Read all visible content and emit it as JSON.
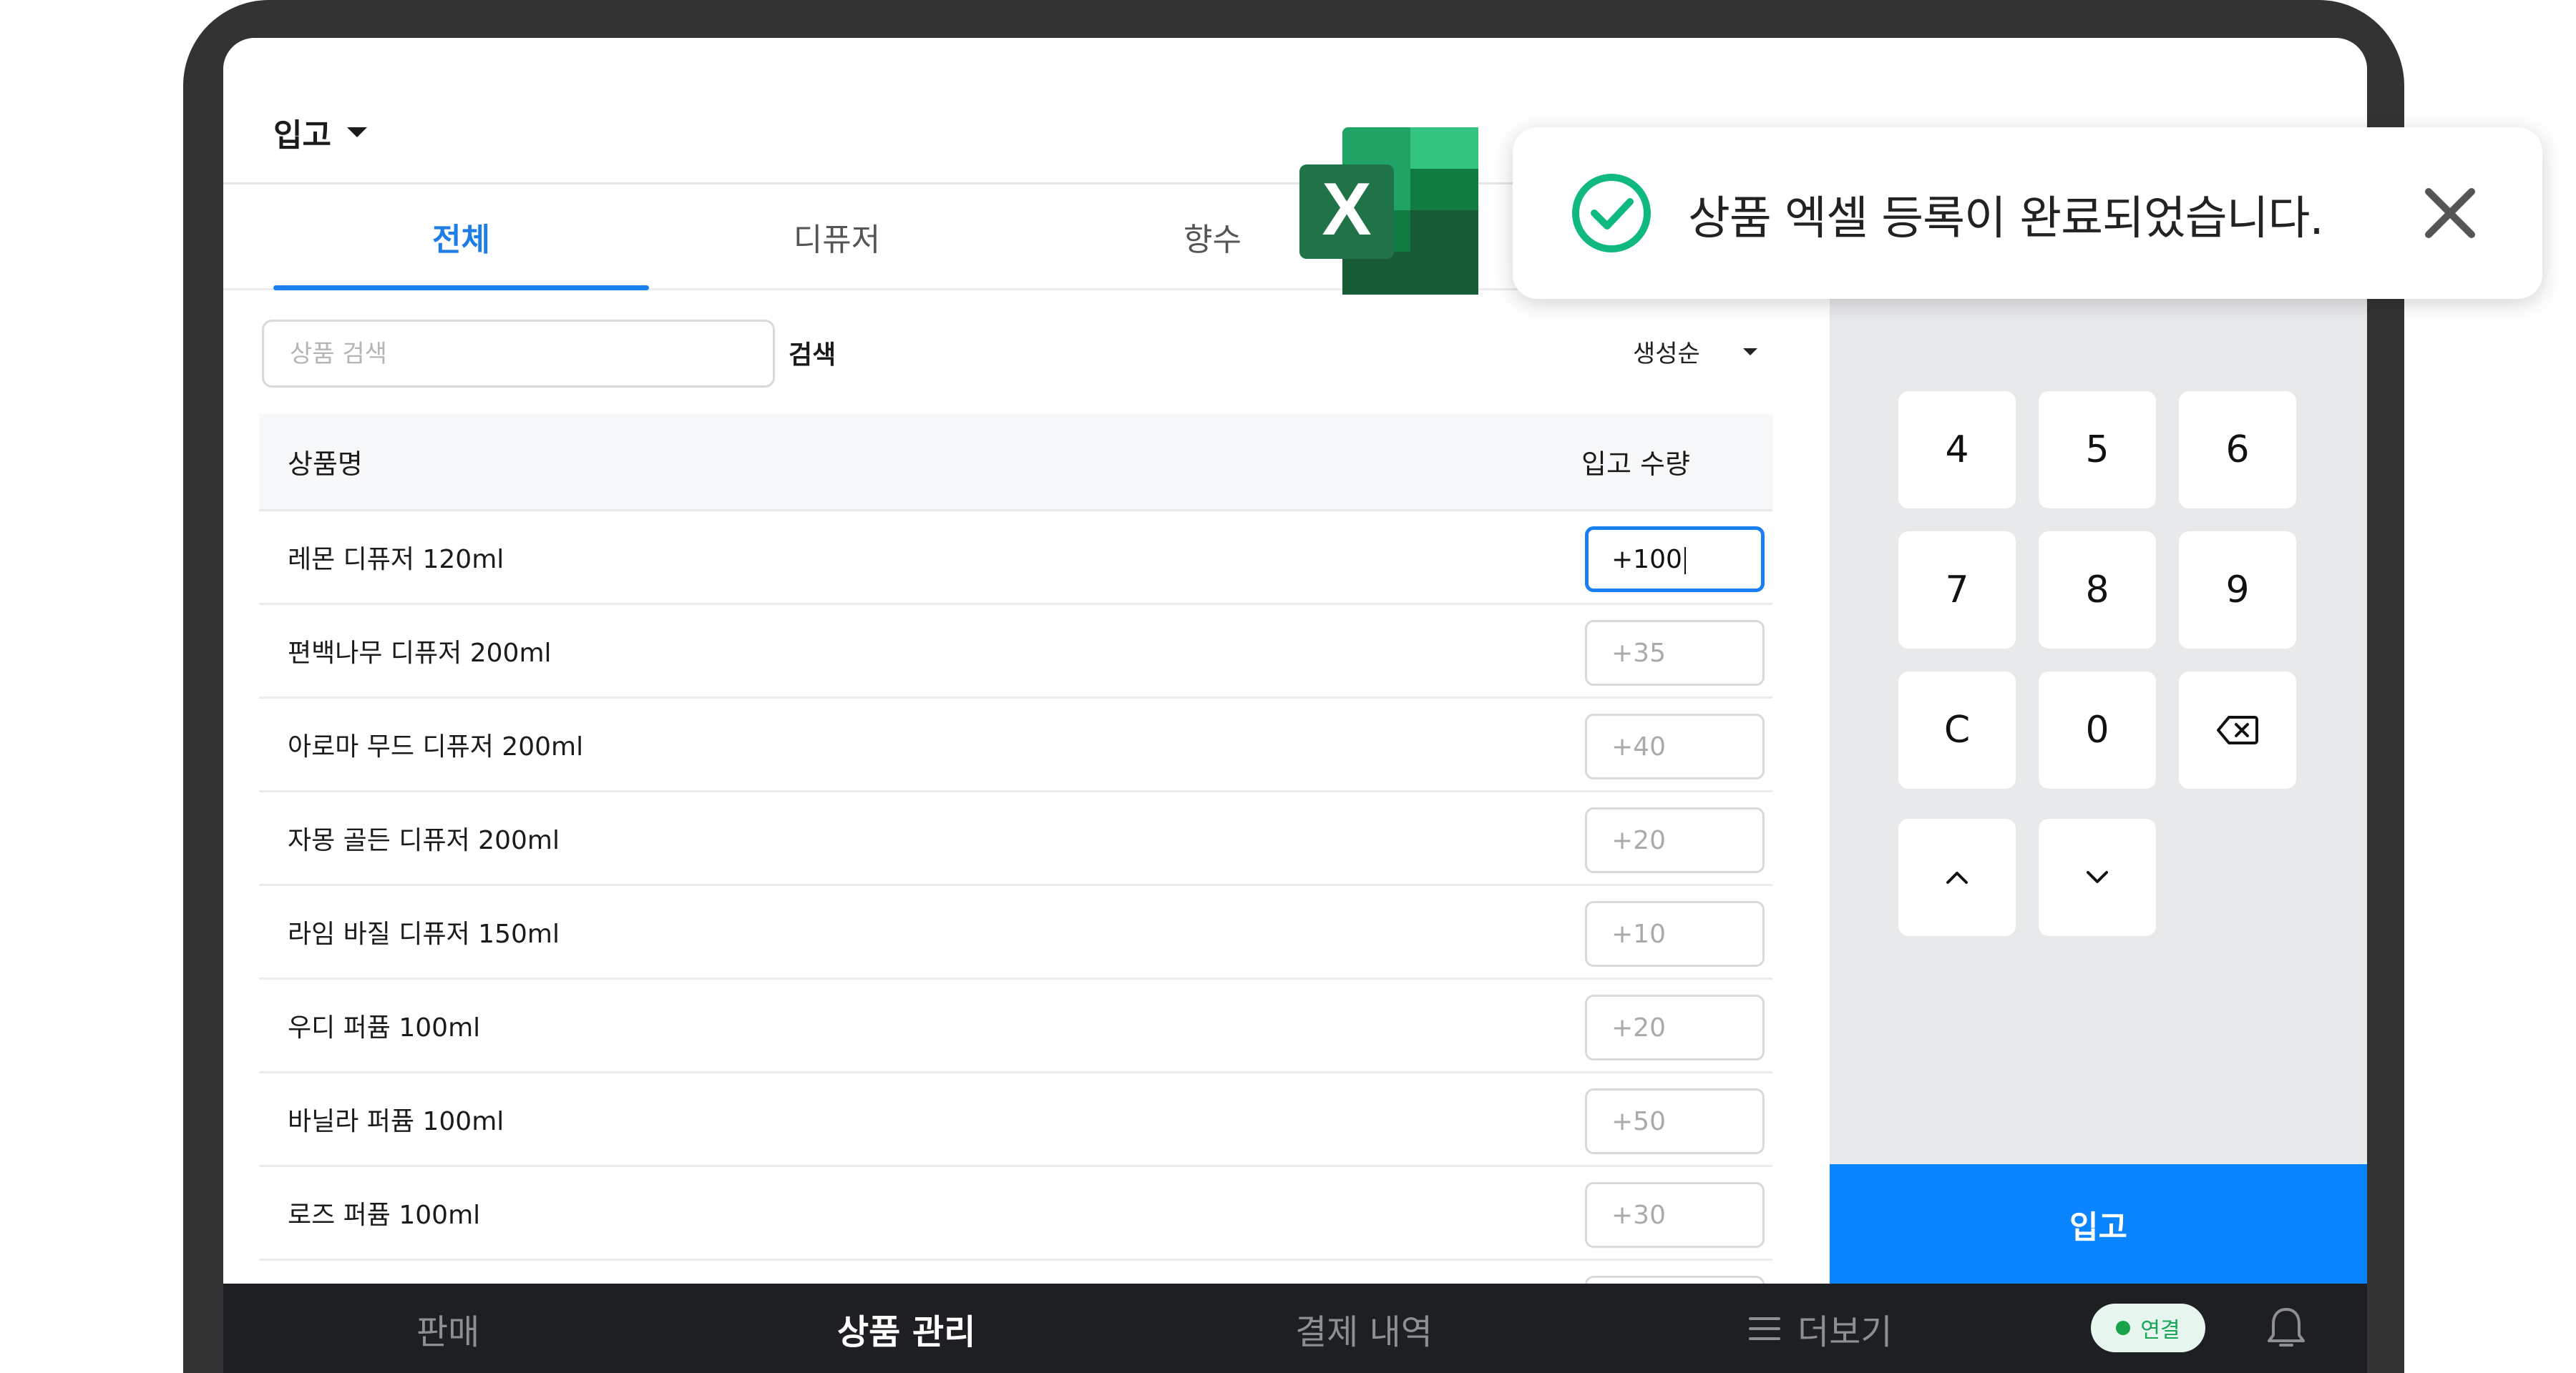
{
  "header": {
    "title": "입고"
  },
  "tabs": [
    {
      "label": "전체",
      "active": true
    },
    {
      "label": "디퓨저",
      "active": false
    },
    {
      "label": "향수",
      "active": false
    }
  ],
  "search": {
    "placeholder": "상품 검색",
    "button_label": "검색",
    "sort_label": "생성순"
  },
  "table": {
    "columns": [
      "상품명",
      "입고 수량"
    ],
    "rows": [
      {
        "name": "레몬 디퓨저 120ml",
        "qty": "+100"
      },
      {
        "name": "편백나무 디퓨저 200ml",
        "qty": "+35"
      },
      {
        "name": "아로마 무드 디퓨저 200ml",
        "qty": "+40"
      },
      {
        "name": "자몽 골든 디퓨저 200ml",
        "qty": "+20"
      },
      {
        "name": "라임 바질 디퓨저 150ml",
        "qty": "+10"
      },
      {
        "name": "우디 퍼퓸 100ml",
        "qty": "+20"
      },
      {
        "name": "바닐라 퍼퓸 100ml",
        "qty": "+50"
      },
      {
        "name": "로즈 퍼퓸 100ml",
        "qty": "+30"
      }
    ]
  },
  "keypad": {
    "keys": [
      "4",
      "5",
      "6",
      "7",
      "8",
      "9",
      "C",
      "0"
    ],
    "backspace_icon": "backspace-icon",
    "up_icon": "chevron-up-icon",
    "down_icon": "chevron-down-icon",
    "enter_label": "입고"
  },
  "bottom_nav": {
    "items": [
      "판매",
      "상품 관리",
      "결제 내역",
      "더보기"
    ],
    "active_index": 1,
    "connection_label": "연결",
    "bell_icon": "bell-icon"
  },
  "toast": {
    "message": "상품 엑셀 등록이 완료되었습니다.",
    "icon": "check-circle-icon",
    "close_icon": "close-icon"
  },
  "excel_icon": {
    "letter": "X"
  },
  "colors": {
    "accent": "#0a84ff",
    "success": "#10b981",
    "excel_green": "#1f7346"
  }
}
